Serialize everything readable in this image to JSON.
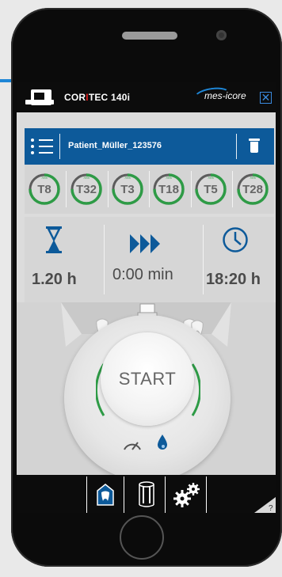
{
  "topbar": {
    "brand_prefix": "COR",
    "brand_separator": "I",
    "brand_suffix": "TEC 140i",
    "partner_logo": "mes-icore",
    "close_label": "✕",
    "icons": {
      "machine": "machine-logo-icon",
      "close": "close-icon"
    }
  },
  "patient": {
    "name": "Patient_Müller_123576",
    "menu_icon": "list-menu-icon",
    "delete_icon": "trash-icon"
  },
  "tools": [
    {
      "name": "T8",
      "percent_label": "75%",
      "level": 0.75
    },
    {
      "name": "T32",
      "percent_label": "75%",
      "level": 0.75
    },
    {
      "name": "T3",
      "percent_label": "75%",
      "level": 0.75
    },
    {
      "name": "T18",
      "percent_label": "75%",
      "level": 0.75
    },
    {
      "name": "T5",
      "percent_label": "75%",
      "level": 0.75
    },
    {
      "name": "T28",
      "percent_label": "75%",
      "level": 0.75
    }
  ],
  "info": {
    "duration": "1.20 h",
    "remaining": "0:00 min",
    "clock": "18:20 h",
    "icons": [
      "hourglass-icon",
      "fast-forward-icon",
      "clock-icon"
    ]
  },
  "start": {
    "label": "START",
    "icons": [
      "tooth-icon",
      "block-icon",
      "teeth-icon",
      "gauge-icon",
      "water-drop-icon"
    ]
  },
  "bottom_nav": {
    "items": [
      {
        "name": "tooth-house-icon"
      },
      {
        "name": "material-block-icon"
      },
      {
        "name": "settings-gears-icon"
      }
    ],
    "help_label": "?"
  },
  "colors": {
    "accent": "#0d5a9a",
    "progress": "#2e9b46",
    "highlight": "#1e86d6",
    "brand_red": "#e41f1f"
  }
}
